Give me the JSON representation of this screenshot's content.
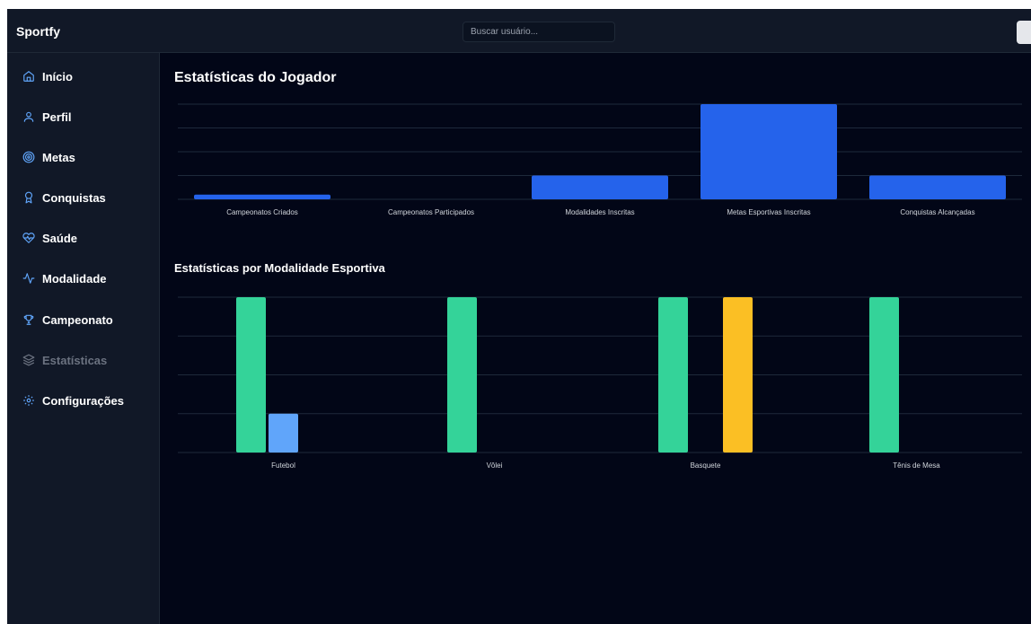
{
  "app": {
    "brand": "Sportfy"
  },
  "search": {
    "placeholder": "Buscar usuário..."
  },
  "sidebar": {
    "items": [
      {
        "label": "Início",
        "icon": "home-icon",
        "active": true
      },
      {
        "label": "Perfil",
        "icon": "user-icon",
        "active": true
      },
      {
        "label": "Metas",
        "icon": "target-icon",
        "active": true
      },
      {
        "label": "Conquistas",
        "icon": "award-icon",
        "active": true
      },
      {
        "label": "Saúde",
        "icon": "heart-pulse-icon",
        "active": true
      },
      {
        "label": "Modalidade",
        "icon": "activity-icon",
        "active": true
      },
      {
        "label": "Campeonato",
        "icon": "trophy-icon",
        "active": true
      },
      {
        "label": "Estatísticas",
        "icon": "layers-icon",
        "active": false
      },
      {
        "label": "Configurações",
        "icon": "settings-icon",
        "active": true
      }
    ]
  },
  "main": {
    "title1": "Estatísticas do Jogador",
    "title2": "Estatísticas por Modalidade Esportiva"
  },
  "colors": {
    "accent": "#2563eb",
    "green": "#34d399",
    "lightblue": "#60a5fa",
    "yellow": "#fbbf24"
  },
  "chart_data": [
    {
      "type": "bar",
      "categories": [
        "Campeonatos Criados",
        "Campeonatos Participados",
        "Modalidades Inscritas",
        "Metas Esportivas Inscritas",
        "Conquistas Alcançadas"
      ],
      "values": [
        0.2,
        0,
        1,
        4,
        1
      ],
      "ylim": [
        0,
        4
      ],
      "grid": true
    },
    {
      "type": "bar",
      "categories": [
        "Futebol",
        "Vôlei",
        "Basquete",
        "Tênis de Mesa"
      ],
      "series": [
        {
          "values": [
            4,
            4,
            4,
            4
          ],
          "color": "#34d399"
        },
        {
          "values": [
            1,
            0,
            0,
            0
          ],
          "color": "#60a5fa"
        },
        {
          "values": [
            0,
            0,
            4,
            0
          ],
          "color": "#fbbf24"
        }
      ],
      "ylim": [
        0,
        4
      ],
      "grid": true
    }
  ]
}
